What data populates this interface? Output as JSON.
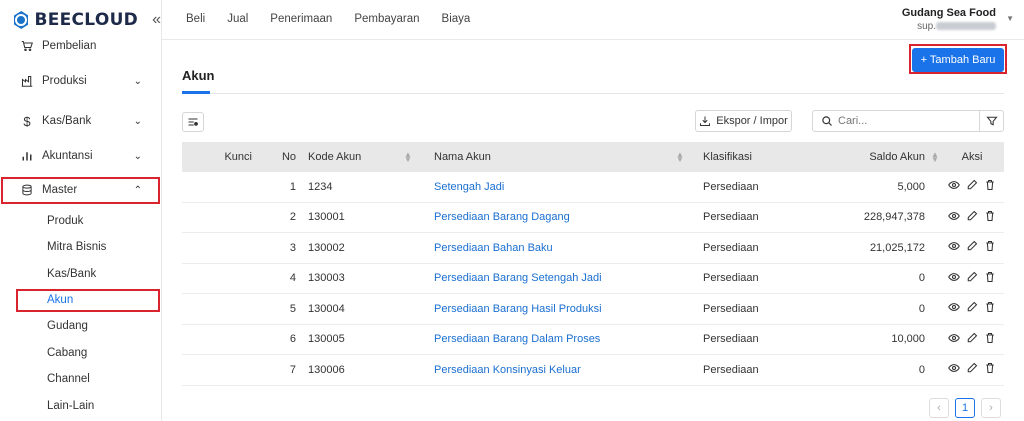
{
  "brand": {
    "name": "BEECLOUD"
  },
  "sidebar": {
    "items": [
      {
        "label": "Pembelian",
        "icon": "cart-icon"
      },
      {
        "label": "Produksi",
        "icon": "factory-icon"
      },
      {
        "label": "Kas/Bank",
        "icon": "dollar-icon"
      },
      {
        "label": "Akuntansi",
        "icon": "bar-chart-icon"
      },
      {
        "label": "Master",
        "icon": "database-icon",
        "expanded": true
      }
    ],
    "master_sub": [
      "Produk",
      "Mitra Bisnis",
      "Kas/Bank",
      "Akun",
      "Gudang",
      "Cabang",
      "Channel",
      "Lain-Lain"
    ],
    "active_sub": "Akun"
  },
  "topnav": [
    "Beli",
    "Jual",
    "Penerimaan",
    "Pembayaran",
    "Biaya"
  ],
  "user": {
    "company": "Gudang Sea Food",
    "email_prefix": "sup."
  },
  "page": {
    "title": "Akun",
    "add_button": "+ Tambah Baru",
    "export_button": "Ekspor / Impor",
    "search_placeholder": "Cari..."
  },
  "table": {
    "headers": {
      "kunci": "Kunci",
      "no": "No",
      "kode": "Kode Akun",
      "nama": "Nama Akun",
      "klasifikasi": "Klasifikasi",
      "saldo": "Saldo Akun",
      "aksi": "Aksi"
    },
    "rows": [
      {
        "no": "1",
        "kode": "1234",
        "nama": "Setengah Jadi",
        "klasifikasi": "Persediaan",
        "saldo": "5,000"
      },
      {
        "no": "2",
        "kode": "130001",
        "nama": "Persediaan Barang Dagang",
        "klasifikasi": "Persediaan",
        "saldo": "228,947,378"
      },
      {
        "no": "3",
        "kode": "130002",
        "nama": "Persediaan Bahan Baku",
        "klasifikasi": "Persediaan",
        "saldo": "21,025,172"
      },
      {
        "no": "4",
        "kode": "130003",
        "nama": "Persediaan Barang Setengah Jadi",
        "klasifikasi": "Persediaan",
        "saldo": "0"
      },
      {
        "no": "5",
        "kode": "130004",
        "nama": "Persediaan Barang Hasil Produksi",
        "klasifikasi": "Persediaan",
        "saldo": "0"
      },
      {
        "no": "6",
        "kode": "130005",
        "nama": "Persediaan Barang Dalam Proses",
        "klasifikasi": "Persediaan",
        "saldo": "10,000"
      },
      {
        "no": "7",
        "kode": "130006",
        "nama": "Persediaan Konsinyasi Keluar",
        "klasifikasi": "Persediaan",
        "saldo": "0"
      }
    ]
  },
  "pagination": {
    "current": "1",
    "prev": "‹",
    "next": "›"
  },
  "colors": {
    "primary": "#1a73e8",
    "highlight": "#d9232d",
    "link": "#1a6fd1"
  }
}
